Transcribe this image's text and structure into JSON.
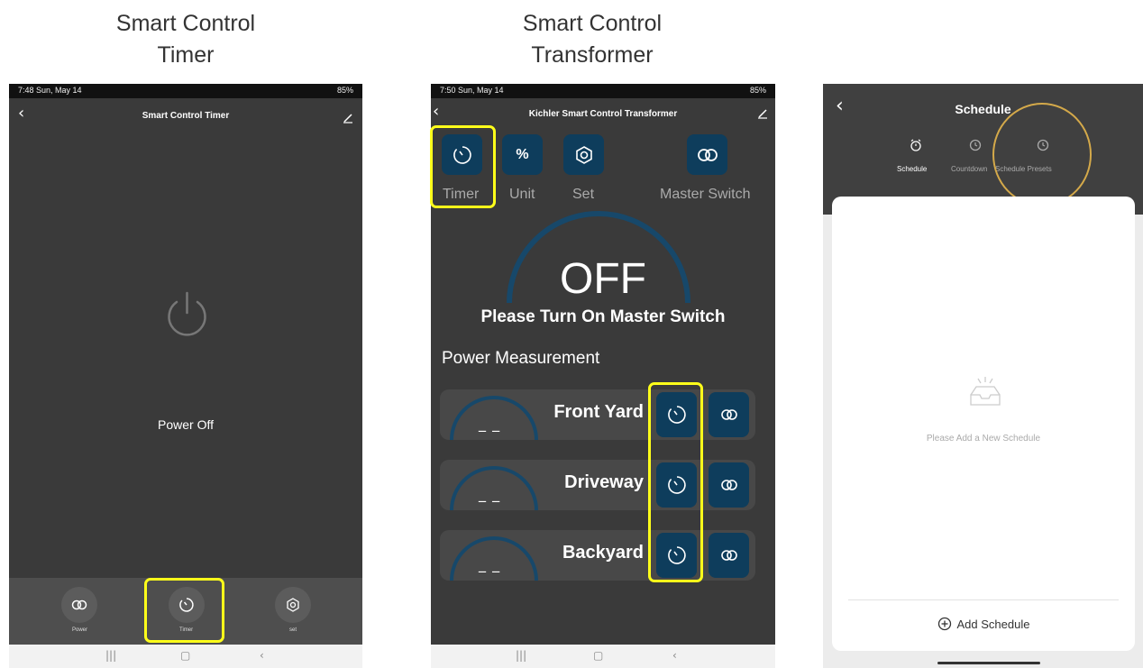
{
  "captions": {
    "timer": [
      "Smart Control",
      "Timer"
    ],
    "transformer": [
      "Smart Control",
      "Transformer"
    ]
  },
  "screen1": {
    "status_left": "7:48  Sun, May 14",
    "status_right": "85%",
    "title": "Smart Control Timer",
    "power_state": "Power Off",
    "tabs": [
      {
        "label": "Power",
        "icon": "loop-icon"
      },
      {
        "label": "Timer",
        "icon": "timer-icon"
      },
      {
        "label": "set",
        "icon": "settings-icon"
      }
    ]
  },
  "screen2": {
    "status_left": "7:50  Sun, May 14",
    "status_right": "85%",
    "title": "Kichler Smart Control Transformer",
    "toolbar": [
      {
        "label": "Timer",
        "icon": "timer-icon"
      },
      {
        "label": "Unit",
        "icon": "percent-icon",
        "glyph": "%"
      },
      {
        "label": "Set",
        "icon": "settings-icon"
      },
      {
        "label": "Master Switch",
        "icon": "loop-icon"
      }
    ],
    "state": "OFF",
    "message": "Please Turn On Master Switch",
    "section_title": "Power Measurement",
    "zones": [
      {
        "name": "Front Yard",
        "value": "_ _"
      },
      {
        "name": "Driveway",
        "value": "_ _"
      },
      {
        "name": "Backyard",
        "value": "_ _"
      }
    ]
  },
  "screen3": {
    "title": "Schedule",
    "tabs": [
      {
        "label": "Schedule",
        "icon": "alarm-clock-icon"
      },
      {
        "label": "Countdown",
        "icon": "clock-icon"
      },
      {
        "label": "Schedule Presets",
        "icon": "clock-icon"
      }
    ],
    "empty_message": "Please Add a New Schedule",
    "add_label": "Add Schedule"
  },
  "colors": {
    "screen_bg": "#3a3a3a",
    "tile_blue": "#0e3d5c",
    "highlight_yellow": "#ffff1a",
    "highlight_circle": "#d4a94a"
  }
}
